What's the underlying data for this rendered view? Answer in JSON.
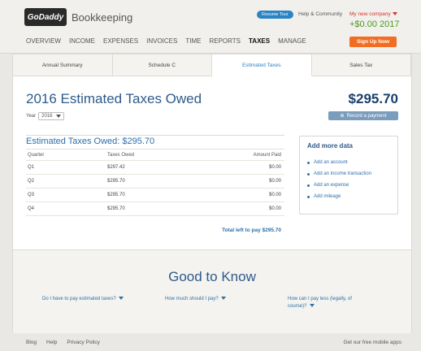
{
  "header": {
    "logo_mark": "GoDaddy",
    "app_name": "Bookkeeping",
    "resume_tour": "Resume Tour",
    "help": "Help & Community",
    "company": "My new company",
    "balance": "+$0.00",
    "balance_year": "2017",
    "signup": "Sign Up Now",
    "nav": [
      "OVERVIEW",
      "INCOME",
      "EXPENSES",
      "INVOICES",
      "TIME",
      "REPORTS",
      "TAXES",
      "MANAGE"
    ],
    "active_nav": "TAXES"
  },
  "tabs": [
    "Annual Summary",
    "Schedule C",
    "Estimated Taxes",
    "Sales Tax"
  ],
  "active_tab": "Estimated Taxes",
  "main": {
    "title": "2016 Estimated Taxes Owed",
    "year_label": "Year",
    "year_value": "2016",
    "amount": "$295.70",
    "record_button": "Record a payment",
    "owed_title": "Estimated Taxes Owed: $295.70",
    "table": {
      "headers": [
        "Quarter",
        "Taxes Owed",
        "Amount Paid"
      ],
      "rows": [
        [
          "Q1",
          "$297.42",
          "$0.00"
        ],
        [
          "Q2",
          "$295.70",
          "$0.00"
        ],
        [
          "Q3",
          "$295.70",
          "$0.00"
        ],
        [
          "Q4",
          "$295.70",
          "$0.00"
        ]
      ]
    },
    "total": "Total left to pay $295.70"
  },
  "more_data": {
    "title": "Add more data",
    "items": [
      "Add an account",
      "Add an income transaction",
      "Add an expense",
      "Add mileage"
    ]
  },
  "good_to_know": {
    "title": "Good to Know",
    "q1": "Do I have to pay estimated taxes?",
    "q2": "How much should I pay?",
    "q3_line1": "How can I pay less (legally, of",
    "q3_line2": "course)?"
  },
  "footer": {
    "links": [
      "Blog",
      "Help",
      "Privacy Policy"
    ],
    "right": "Get our free mobile apps"
  },
  "colors": {
    "brand_blue": "#2e5a8a",
    "link_blue": "#2e6fab",
    "signup_orange": "#f26c21",
    "balance_green": "#4b9a1f",
    "company_red": "#d3342c"
  }
}
